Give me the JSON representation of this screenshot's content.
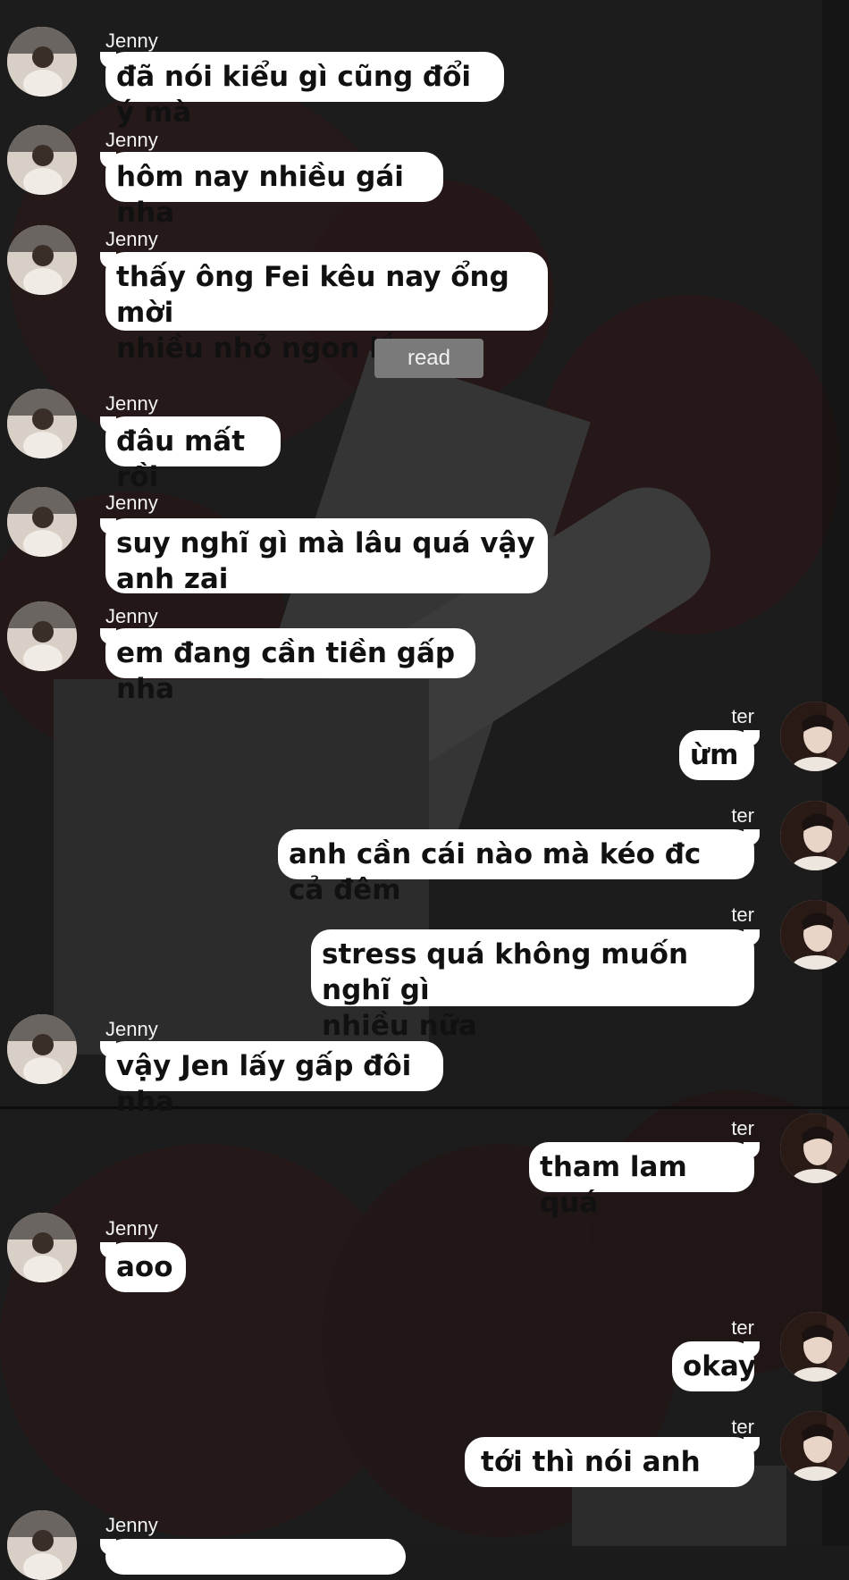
{
  "contacts": {
    "jenny": "Jenny",
    "ter": "ter"
  },
  "status": {
    "read_label": "read"
  },
  "messages": [
    {
      "sender": "Jenny",
      "text": "đã nói kiểu gì cũng đổi ý mà"
    },
    {
      "sender": "Jenny",
      "text": "hôm nay nhiều gái nha"
    },
    {
      "sender": "Jenny",
      "text": "thấy ông Fei kêu nay ổng mời\nnhiều nhỏ ngon lắm"
    },
    {
      "sender": "Jenny",
      "text": "đâu mất rồi"
    },
    {
      "sender": "Jenny",
      "text": "suy nghĩ gì mà lâu quá vậy\nanh zai"
    },
    {
      "sender": "Jenny",
      "text": "em đang cần tiền gấp nha"
    },
    {
      "sender": "ter",
      "text": "ừm"
    },
    {
      "sender": "ter",
      "text": "anh cần cái nào mà kéo đc cả đêm"
    },
    {
      "sender": "ter",
      "text": "stress quá không muốn nghĩ gì\nnhiều nữa"
    },
    {
      "sender": "Jenny",
      "text": "vậy Jen lấy gấp đôi nha"
    },
    {
      "sender": "ter",
      "text": "tham lam quá"
    },
    {
      "sender": "Jenny",
      "text": "aoo"
    },
    {
      "sender": "ter",
      "text": "okay"
    },
    {
      "sender": "ter",
      "text": "tới thì nói anh"
    },
    {
      "sender": "Jenny",
      "text": ""
    }
  ],
  "colors": {
    "bubble": "#ffffff",
    "bubble_text": "#111111",
    "name_text": "#f2f2f2",
    "read_badge": "#7a7a7a",
    "background": "#1b1b1b"
  },
  "icons": {
    "jenny_avatar": "jenny-avatar",
    "ter_avatar": "ter-avatar"
  }
}
